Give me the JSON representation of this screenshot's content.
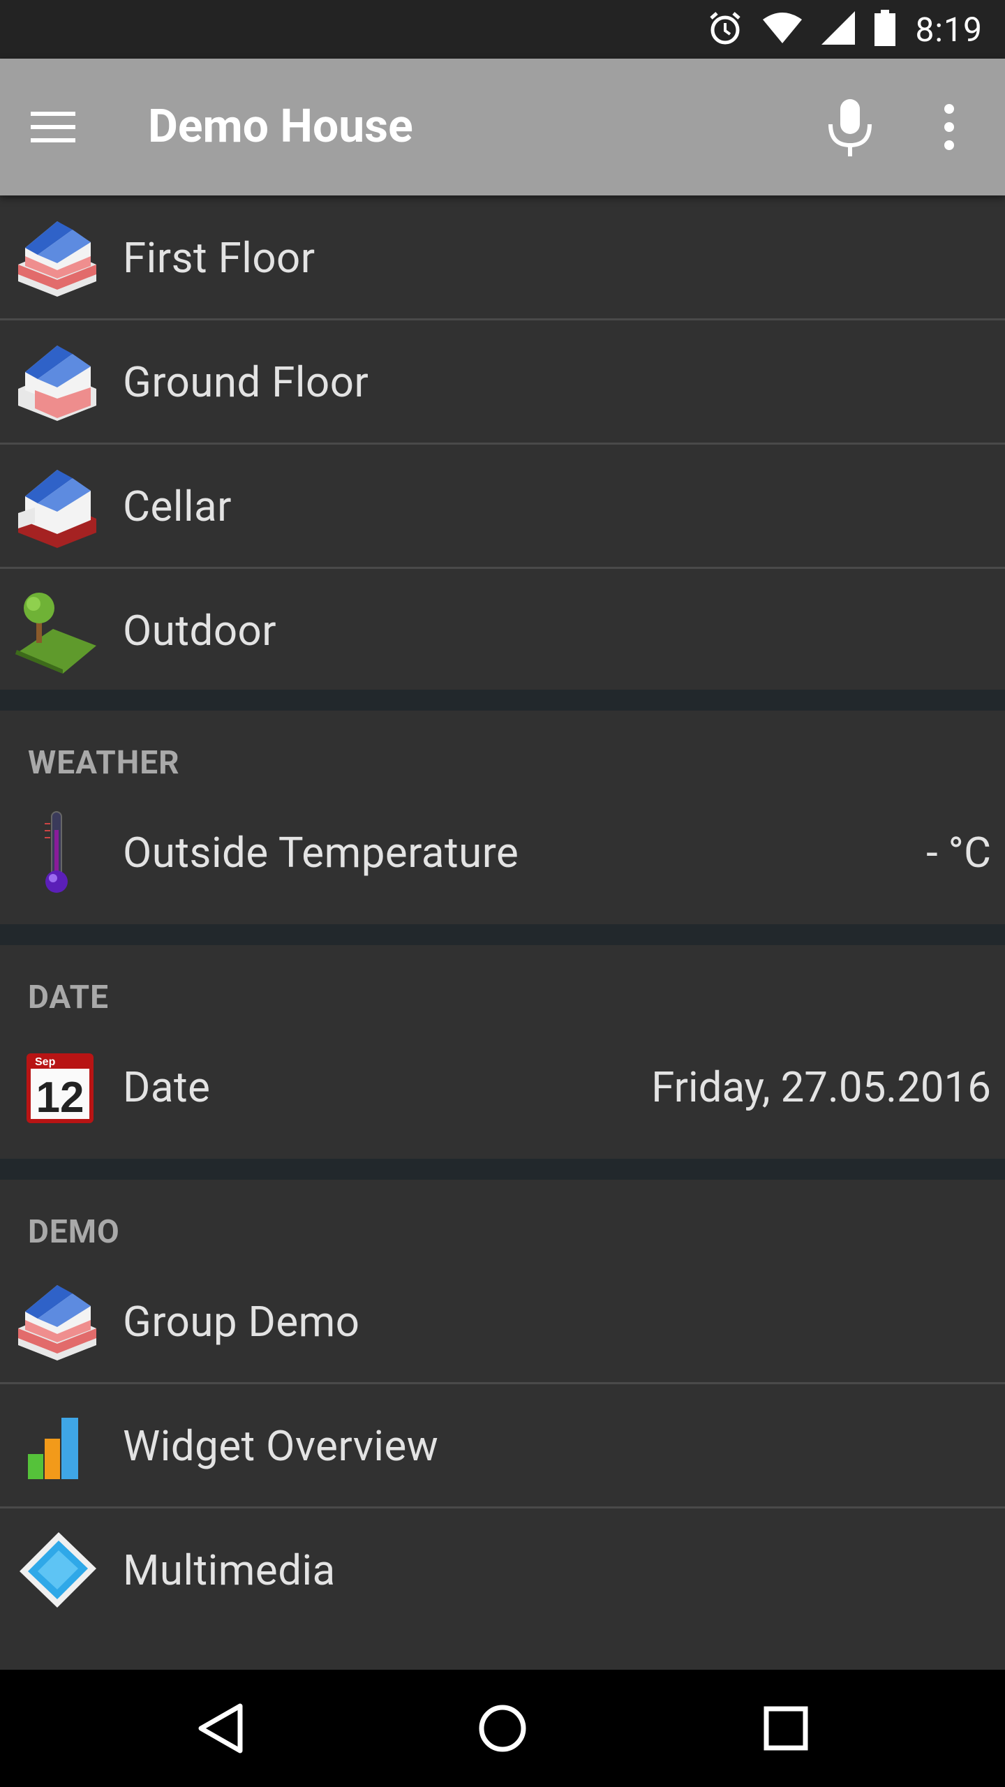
{
  "status_bar": {
    "time": "8:19",
    "icons": [
      "alarm-icon",
      "wifi-icon",
      "signal-icon",
      "battery-icon"
    ]
  },
  "app_bar": {
    "title": "Demo House",
    "menu_icon": "hamburger-menu-icon",
    "mic_icon": "microphone-icon",
    "more_icon": "more-vert-icon",
    "background": "#a0a0a0"
  },
  "floors": [
    {
      "label": "First Floor",
      "icon": "house-first-floor-icon"
    },
    {
      "label": "Ground Floor",
      "icon": "house-ground-floor-icon"
    },
    {
      "label": "Cellar",
      "icon": "house-cellar-icon"
    },
    {
      "label": "Outdoor",
      "icon": "garden-icon"
    }
  ],
  "weather": {
    "header": "WEATHER",
    "items": [
      {
        "label": "Outside Temperature",
        "value": "- °C",
        "icon": "thermometer-icon"
      }
    ]
  },
  "date": {
    "header": "DATE",
    "items": [
      {
        "label": "Date",
        "value": "Friday, 27.05.2016",
        "icon": "calendar-icon",
        "icon_text": "12",
        "icon_month": "Sep"
      }
    ]
  },
  "demo": {
    "header": "DEMO",
    "items": [
      {
        "label": "Group Demo",
        "icon": "house-group-icon"
      },
      {
        "label": "Widget Overview",
        "icon": "bar-chart-icon"
      },
      {
        "label": "Multimedia",
        "icon": "film-strip-icon"
      }
    ]
  },
  "nav_bar": {
    "icons": [
      "back-icon",
      "home-icon",
      "recents-icon"
    ]
  },
  "colors": {
    "card": "#313131",
    "gap": "#22282c",
    "text": "#e3e3e3",
    "section_header": "#a9a9a9"
  }
}
